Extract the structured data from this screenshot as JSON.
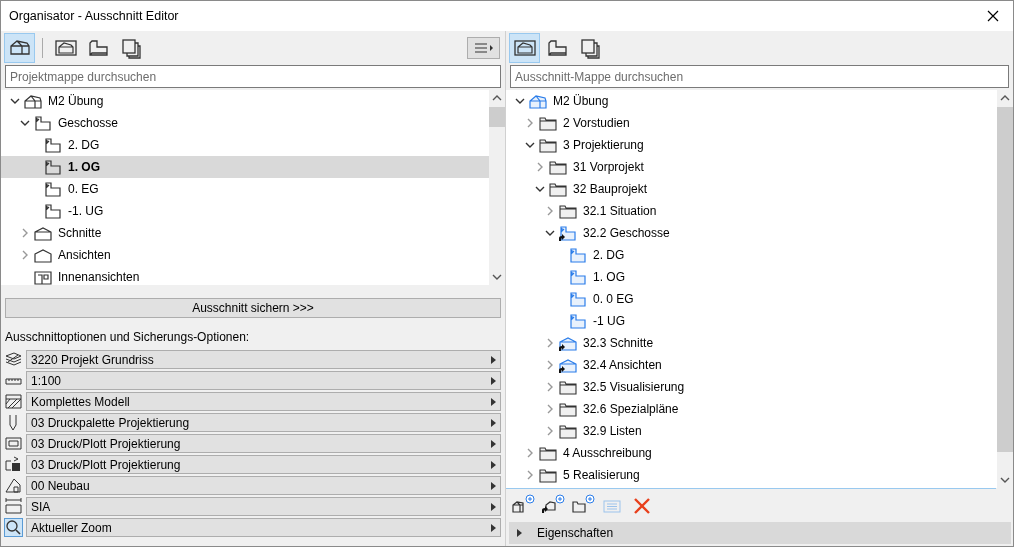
{
  "window": {
    "title": "Organisator - Ausschnitt Editor"
  },
  "left_toolbar": [
    {
      "kind": "project",
      "selected": true
    },
    {
      "kind": "view-map",
      "selected": false
    },
    {
      "kind": "layout",
      "selected": false
    },
    {
      "kind": "publisher",
      "selected": false
    }
  ],
  "left_search": {
    "placeholder": "Projektmappe durchsuchen"
  },
  "left_tree": {
    "nodes": [
      {
        "label": "M2 Übung",
        "kind": "project",
        "expanded": true,
        "selected": false,
        "children": [
          {
            "label": "Geschosse",
            "kind": "story",
            "expanded": true,
            "selected": false,
            "children": [
              {
                "label": "2. DG",
                "kind": "story",
                "selected": false
              },
              {
                "label": "1. OG",
                "kind": "story",
                "selected": true
              },
              {
                "label": "0. EG",
                "kind": "story",
                "selected": false
              },
              {
                "label": "-1. UG",
                "kind": "story",
                "selected": false
              }
            ]
          },
          {
            "label": "Schnitte",
            "kind": "section",
            "expanded": false,
            "selected": false
          },
          {
            "label": "Ansichten",
            "kind": "elevation",
            "expanded": false,
            "selected": false
          },
          {
            "label": "Innenansichten",
            "kind": "interior",
            "selected": false
          }
        ]
      }
    ]
  },
  "save_button": "Ausschnitt sichern >>>",
  "options_label": "Ausschnittoptionen und Sicherungs-Optionen:",
  "options": [
    {
      "kind": "layers",
      "value": "3220 Projekt Grundriss"
    },
    {
      "kind": "scale",
      "value": "1:100"
    },
    {
      "kind": "model",
      "value": "Komplettes Modell"
    },
    {
      "kind": "pen",
      "value": "03 Druckpalette Projektierung"
    },
    {
      "kind": "display",
      "value": "03 Druck/Plott Projektierung"
    },
    {
      "kind": "override",
      "value": "03 Druck/Plott Projektierung"
    },
    {
      "kind": "renovation",
      "value": "00 Neubau"
    },
    {
      "kind": "dimension",
      "value": "SIA"
    },
    {
      "kind": "zoom",
      "value": "Aktueller Zoom"
    }
  ],
  "right_toolbar": [
    {
      "kind": "view-map",
      "selected": true
    },
    {
      "kind": "layout",
      "selected": false
    },
    {
      "kind": "publisher",
      "selected": false
    }
  ],
  "right_search": {
    "placeholder": "Ausschnitt-Mappe durchsuchen"
  },
  "right_tree": {
    "nodes": [
      {
        "label": "M2 Übung",
        "kind": "view-project",
        "expanded": true,
        "selected": false,
        "children": [
          {
            "label": "2 Vorstudien",
            "kind": "folder",
            "expanded": false,
            "selected": false
          },
          {
            "label": "3 Projektierung",
            "kind": "folder",
            "expanded": true,
            "selected": false,
            "children": [
              {
                "label": "31 Vorprojekt",
                "kind": "folder",
                "expanded": false,
                "selected": false
              },
              {
                "label": "32 Bauprojekt",
                "kind": "folder",
                "expanded": true,
                "selected": false,
                "children": [
                  {
                    "label": "32.1 Situation",
                    "kind": "folder",
                    "expanded": false,
                    "selected": false
                  },
                  {
                    "label": "32.2 Geschosse",
                    "kind": "view-story-link",
                    "expanded": true,
                    "selected": false,
                    "children": [
                      {
                        "label": "2. DG",
                        "kind": "view-story",
                        "selected": false
                      },
                      {
                        "label": "1. OG",
                        "kind": "view-story",
                        "selected": false
                      },
                      {
                        "label": "0. 0 EG",
                        "kind": "view-story",
                        "selected": false
                      },
                      {
                        "label": "-1 UG",
                        "kind": "view-story",
                        "selected": false
                      }
                    ]
                  },
                  {
                    "label": "32.3 Schnitte",
                    "kind": "view-section-link",
                    "expanded": false,
                    "selected": false
                  },
                  {
                    "label": "32.4 Ansichten",
                    "kind": "view-section-link",
                    "expanded": false,
                    "selected": false
                  },
                  {
                    "label": "32.5 Visualisierung",
                    "kind": "folder",
                    "expanded": false,
                    "selected": false
                  },
                  {
                    "label": "32.6 Spezialpläne",
                    "kind": "folder",
                    "expanded": false,
                    "selected": false
                  },
                  {
                    "label": "32.9 Listen",
                    "kind": "folder",
                    "expanded": false,
                    "selected": false
                  }
                ]
              }
            ]
          },
          {
            "label": "4 Ausschreibung",
            "kind": "folder",
            "expanded": false,
            "selected": false
          },
          {
            "label": "5 Realisierung",
            "kind": "folder",
            "expanded": false,
            "selected": false
          }
        ]
      }
    ]
  },
  "actions": [
    {
      "kind": "new-view",
      "disabled": false
    },
    {
      "kind": "clone",
      "disabled": false
    },
    {
      "kind": "new-folder",
      "disabled": false
    },
    {
      "kind": "settings",
      "disabled": true
    },
    {
      "kind": "delete",
      "disabled": false
    }
  ],
  "properties_panel": {
    "label": "Eigenschaften",
    "expanded": false
  }
}
